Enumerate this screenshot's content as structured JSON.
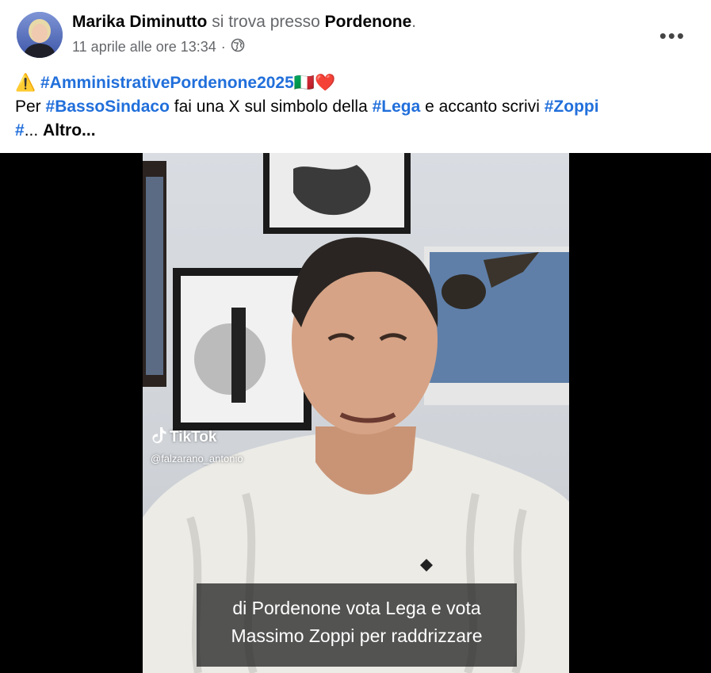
{
  "post": {
    "author": "Marika Diminutto",
    "location_prefix": "si trova presso",
    "location": "Pordenone",
    "location_suffix": ".",
    "timestamp": "11 aprile alle ore 13:34",
    "timestamp_separator": "·",
    "privacy_icon": "globe-icon",
    "more_label": "•••"
  },
  "text": {
    "warning_icon": "⚠️",
    "hashtag_main": "#AmministrativePordenone2025",
    "flag_heart": "🇮🇹❤️",
    "line2_prefix": "Per",
    "hashtag_sindaco": "#BassoSindaco",
    "line2_mid": "fai una X sul simbolo della",
    "hashtag_lega": "#Lega",
    "line2_mid2": "e accanto scrivi",
    "hashtag_zoppi": "#Zoppi",
    "line3_hash": "#",
    "ellipsis": "...",
    "see_more": "Altro..."
  },
  "video": {
    "watermark_brand": "TikTok",
    "watermark_handle": "@falzarano_antonio",
    "subtitle_line1": "di Pordenone vota Lega e vota",
    "subtitle_line2": "Massimo Zoppi per raddrizzare"
  },
  "colors": {
    "hashtag": "#216fdb",
    "muted": "#65676b",
    "text": "#050505"
  }
}
